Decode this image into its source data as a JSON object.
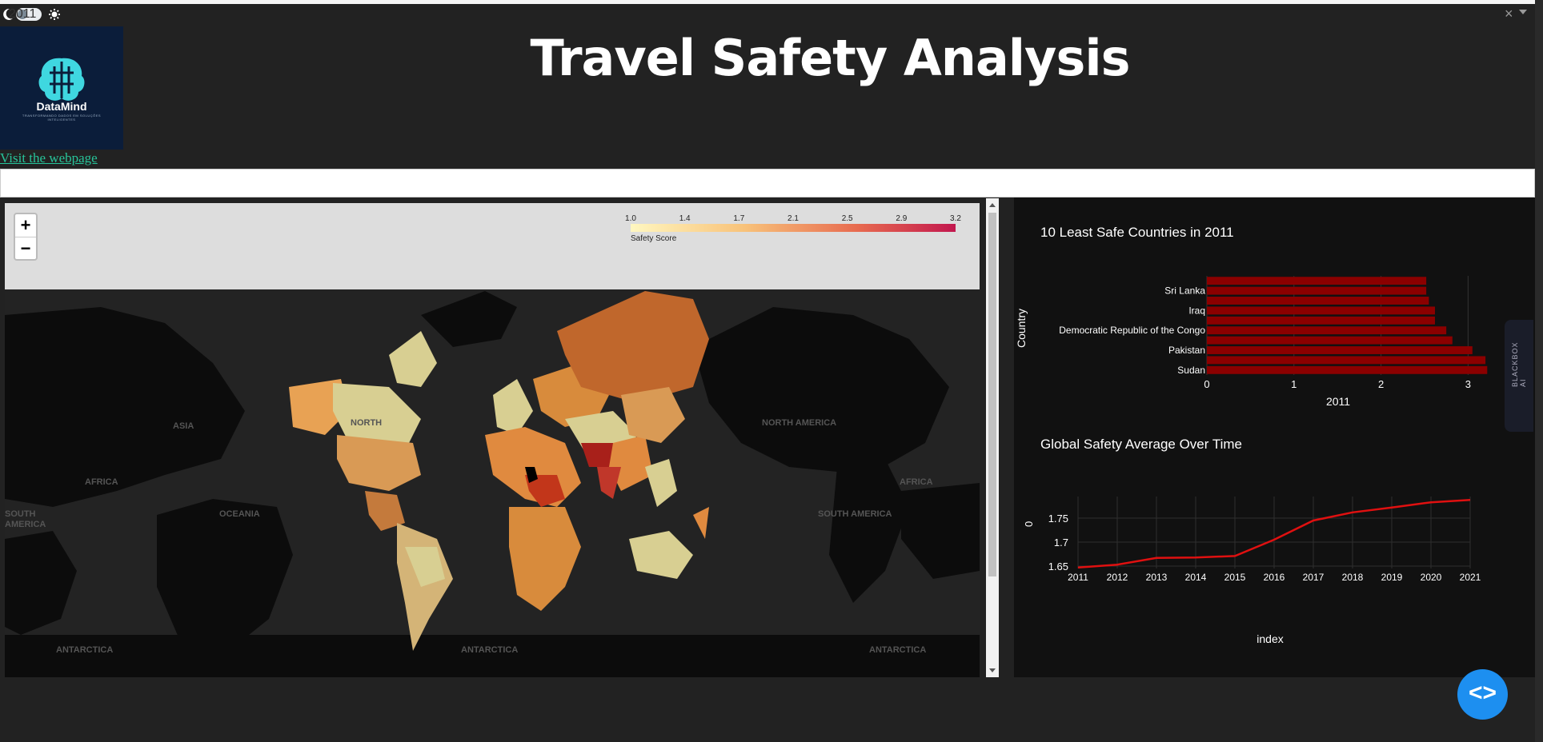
{
  "app": {
    "title": "Travel Safety Analysis",
    "link_text": "Visit the webpage",
    "logo": {
      "name": "DataMind",
      "tagline": "TRANSFORMANDO DADOS EM SOLUÇÕES INTELIGENTES"
    },
    "theme_icons": {
      "dark": "moon-icon",
      "light": "sun-icon"
    }
  },
  "dropdown": {
    "selected": "2011",
    "clear_icon": "close-icon",
    "arrow_icon": "chevron-down-icon"
  },
  "map": {
    "zoom_in": "+",
    "zoom_out": "−",
    "colorbar": {
      "title": "Safety Score",
      "ticks": [
        "1.0",
        "1.4",
        "1.7",
        "2.1",
        "2.5",
        "2.9",
        "3.2"
      ]
    },
    "labels": [
      "ASIA",
      "NORTH",
      "AFRICA",
      "OCEANIA",
      "SOUTH",
      "AMERICA",
      "NORTH AMERICA",
      "SOUTH AMERICA",
      "ANTARCTICA"
    ]
  },
  "chart_data": [
    {
      "type": "bar",
      "orientation": "horizontal",
      "title": "10 Least Safe Countries in 2011",
      "xlabel": "2011",
      "ylabel": "Country",
      "xlim": [
        0,
        3.3
      ],
      "xticks": [
        "0",
        "1",
        "2",
        "3"
      ],
      "categories": [
        "Sudan",
        "",
        "Pakistan",
        "",
        "Democratic Republic of the Congo",
        "",
        "Iraq",
        "",
        "Sri Lanka",
        ""
      ],
      "values": [
        3.22,
        3.2,
        3.05,
        2.82,
        2.75,
        2.62,
        2.62,
        2.55,
        2.52,
        2.52
      ],
      "color": "#8b0000"
    },
    {
      "type": "line",
      "title": "Global Safety Average Over Time",
      "xlabel": "index",
      "ylabel": "0",
      "x": [
        "2011",
        "2012",
        "2013",
        "2014",
        "2015",
        "2016",
        "2017",
        "2018",
        "2019",
        "2020",
        "2021"
      ],
      "y": [
        1.647,
        1.653,
        1.667,
        1.668,
        1.671,
        1.705,
        1.745,
        1.762,
        1.772,
        1.783,
        1.788
      ],
      "ylim": [
        1.645,
        1.795
      ],
      "yticks": [
        "1.65",
        "1.7",
        "1.75"
      ],
      "color": "#e01010"
    }
  ],
  "overlay": {
    "code_button": "<>",
    "side_tab": "BLACKBOX AI"
  }
}
